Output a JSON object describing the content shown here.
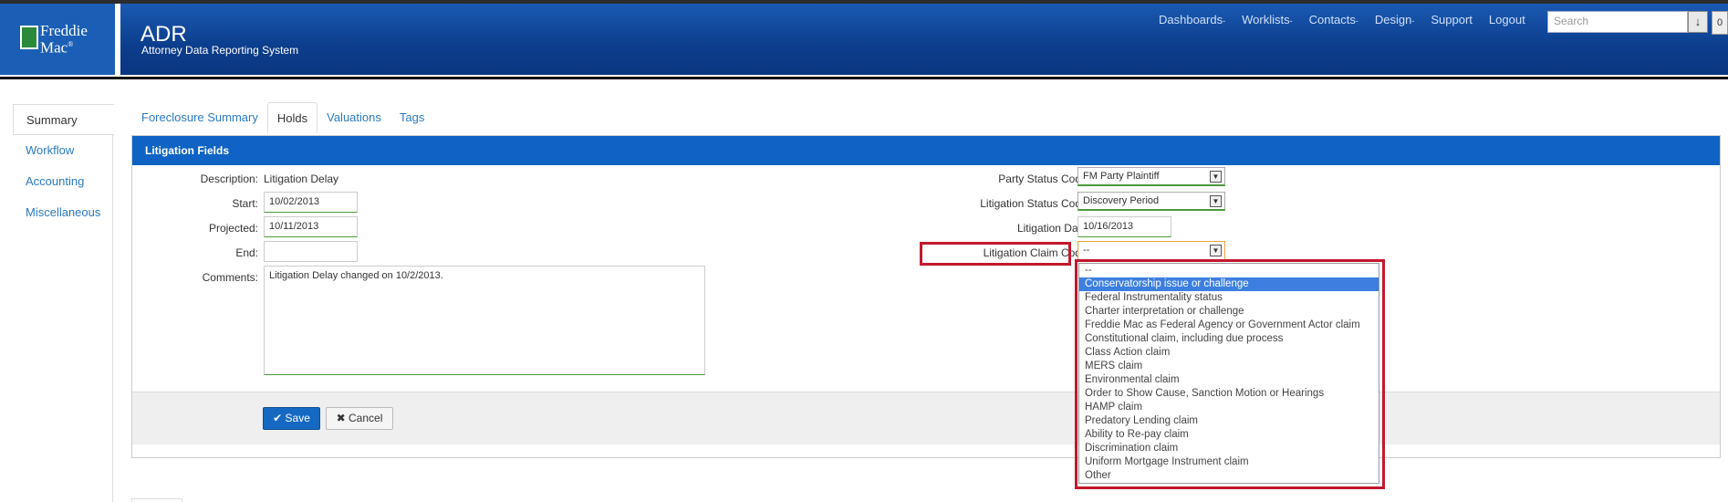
{
  "header": {
    "logo_line1": "Freddie",
    "logo_line2": "Mac",
    "logo_reg": "®",
    "app_title": "ADR",
    "app_subtitle": "Attorney Data Reporting System",
    "nav": [
      {
        "label": "Dashboards",
        "has_caret": true
      },
      {
        "label": "Worklists",
        "has_caret": true
      },
      {
        "label": "Contacts",
        "has_caret": true
      },
      {
        "label": "Design",
        "has_caret": true
      },
      {
        "label": "Support",
        "has_caret": false
      },
      {
        "label": "Logout",
        "has_caret": false
      }
    ],
    "caret": "-",
    "search_placeholder": "Search",
    "download_icon": "↓",
    "badge_count": "0"
  },
  "sidebar": {
    "items": [
      {
        "label": "Summary",
        "active": true
      },
      {
        "label": "Workflow",
        "active": false
      },
      {
        "label": "Accounting",
        "active": false
      },
      {
        "label": "Miscellaneous",
        "active": false
      }
    ]
  },
  "tabs": [
    {
      "label": "Foreclosure Summary",
      "active": false
    },
    {
      "label": "Holds",
      "active": true
    },
    {
      "label": "Valuations",
      "active": false
    },
    {
      "label": "Tags",
      "active": false
    }
  ],
  "panel": {
    "title": "Litigation Fields",
    "left": {
      "description_label": "Description:",
      "description_value": "Litigation Delay",
      "start_label": "Start:",
      "start_value": "10/02/2013",
      "projected_label": "Projected:",
      "projected_value": "10/11/2013",
      "end_label": "End:",
      "end_value": "",
      "comments_label": "Comments:",
      "comments_value": "Litigation Delay changed on 10/2/2013."
    },
    "right": {
      "party_status_label": "Party Status Code:",
      "party_status_value": "FM Party Plaintiff",
      "litigation_status_label": "Litigation Status Code:",
      "litigation_status_value": "Discovery Period",
      "litigation_date_label": "Litigation Date:",
      "litigation_date_value": "10/16/2013",
      "claim_code_label": "Litigation Claim Code:",
      "claim_code_value": "--"
    },
    "save_label": "Save",
    "cancel_label": "Cancel",
    "save_icon": "✔",
    "cancel_icon": "✖"
  },
  "claim_options": [
    "--",
    "Conservatorship issue or challenge",
    "Federal Instrumentality status",
    "Charter interpretation or challenge",
    "Freddie Mac as Federal Agency or Government Actor claim",
    "Constitutional claim, including due process",
    "Class Action claim",
    "MERS claim",
    "Environmental claim",
    "Order to Show Cause, Sanction Motion or Hearings",
    "HAMP claim",
    "Predatory Lending claim",
    "Ability to Re-pay claim",
    "Discrimination claim",
    "Uniform Mortgage Instrument claim",
    "Other"
  ],
  "highlighted_option": "Conservatorship issue or challenge",
  "colors": {
    "header_blue": "#0c3d8c",
    "panel_head": "#0f63c4",
    "highlight_red": "#c2182e",
    "link_blue": "#2a7ac0"
  }
}
